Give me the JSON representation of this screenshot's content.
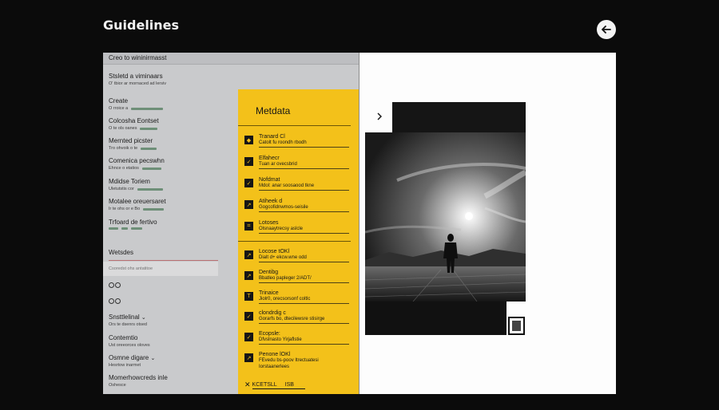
{
  "app": {
    "title": "Guidelines"
  },
  "left_panel": {
    "header": "Creo to wininirmasst",
    "nav_items": [
      {
        "title": "Stsletd a viminaars",
        "subtitle": "O' tbior ar mornaced ad lersiv"
      },
      {
        "title": "Create",
        "subtitle": "O rroice a"
      },
      {
        "title": "Colcosha Eontset",
        "subtitle": "O te ols oanes"
      },
      {
        "title": "Mernted picster",
        "subtitle": "Tro ohvoik o te"
      },
      {
        "title": "Comenica pecswhn",
        "subtitle": "Ehnce o etatios"
      },
      {
        "title": "Mdidse Toriem",
        "subtitle": "Uletutstis cor"
      },
      {
        "title": "Motalee oreuersaret",
        "subtitle": "Ir te ohs or e Bo"
      },
      {
        "title": "Trfoard de fertivo",
        "subtitle": ""
      }
    ],
    "section_title": "Wetsdes",
    "filter_placeholder": "Csoredst ohs antatitoe",
    "lower_items": [
      {
        "title": "Snsttlelinal",
        "subtitle": "Ors te dsenrs otsed"
      },
      {
        "title": "Contemtio",
        "subtitle": "Ust oreeorces oloves"
      },
      {
        "title": "Osmne digare",
        "subtitle": "Hesrtow inarmet"
      },
      {
        "title": "Momerhowcreds inle",
        "subtitle": "Oshesce"
      }
    ]
  },
  "metadata_panel": {
    "title": "Metdata",
    "rows": [
      {
        "icon": "tag-icon",
        "label": "Tranard Cl",
        "value": "Catolt fu roondh rbodh"
      },
      {
        "icon": "check-icon",
        "label": "Elfahecr",
        "value": "Tuan ar ovecsbrid"
      },
      {
        "icon": "check-icon",
        "label": "Nofdmat",
        "value": "Mdol: anar soosaood tkne"
      },
      {
        "icon": "arrow-icon",
        "label": "Atiheek d",
        "value": "Gogcofidnwmos-seisile"
      },
      {
        "icon": "crop-icon",
        "label": "Lotoses",
        "value": "Olsnaaytrecsy aslcle"
      },
      {
        "icon": "arrow-icon",
        "label": "Locose tOKl",
        "value": "Dialt d+ ekcw.wne odd"
      },
      {
        "icon": "arrow-icon",
        "label": "Dentibg",
        "value": "Bbatleo papleger 2/ADT/"
      },
      {
        "icon": "t-icon",
        "label": "Trinaice",
        "value": "Jiolr0, orecsorsonf coltlc"
      },
      {
        "icon": "check-icon",
        "label": "clondrdig c",
        "value": "Gorarfs bo, dtecilewsre stisirge"
      },
      {
        "icon": "check-icon",
        "label": "Ecopsle:",
        "value": "Dfvslnasto Yirjaflstie"
      },
      {
        "icon": "arrow-icon",
        "label": "Penone lOKl",
        "value": "FEvedu bs-poov Itrectuatesi"
      },
      {
        "icon": "arrow-icon",
        "label": "",
        "value": "Iorstaanerlees"
      }
    ],
    "footer_label": "KCETSLL",
    "footer_badge": "ISB"
  },
  "preview": {
    "chevron": "chevron-right-icon",
    "image": "photo-person-on-pier"
  },
  "colors": {
    "background": "#0b0b0b",
    "panel_grey": "#c9cacc",
    "accent_yellow": "#f3c11a",
    "bar_green": "#6e8f78"
  }
}
